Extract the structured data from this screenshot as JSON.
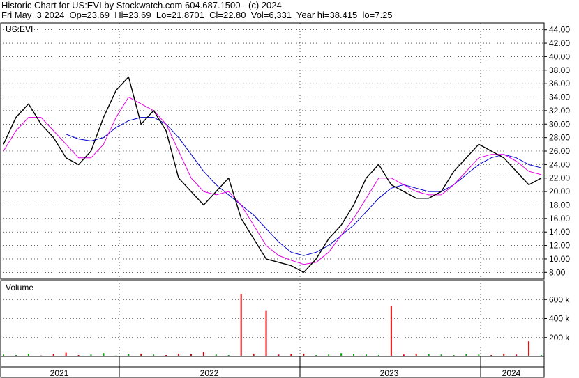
{
  "header": {
    "line1": "Historic Chart for US:EVI by Stockwatch.com 604.687.1500 - (c) 2024",
    "line2": "Fri May  3 2024  Op=23.69  Hi=23.69  Lo=21.8701  Cl=22.80  Vol=6,331  Year hi=38.415  lo=7.25"
  },
  "colors": {
    "price": "#000000",
    "ma_short": "#e600e6",
    "ma_long": "#0000cc",
    "vol_up": "#00aa00",
    "vol_down": "#dd0000",
    "grid": "#000000"
  },
  "chart_data": [
    {
      "type": "line",
      "title": "US:EVI",
      "ylim": [
        7,
        45
      ],
      "yticks": [
        "44.00",
        "42.00",
        "40.00",
        "38.00",
        "36.00",
        "34.00",
        "32.00",
        "30.00",
        "28.00",
        "26.00",
        "24.00",
        "22.00",
        "20.00",
        "18.00",
        "16.00",
        "14.00",
        "12.00",
        "10.00",
        "8.00"
      ],
      "x_labels": [
        "2021",
        "2022",
        "2023",
        "2024"
      ],
      "x": [
        "2020-10",
        "2020-11",
        "2020-12",
        "2021-01",
        "2021-02",
        "2021-03",
        "2021-04",
        "2021-05",
        "2021-06",
        "2021-07",
        "2021-08",
        "2021-09",
        "2021-10",
        "2021-11",
        "2021-12",
        "2022-01",
        "2022-02",
        "2022-03",
        "2022-04",
        "2022-05",
        "2022-06",
        "2022-07",
        "2022-08",
        "2022-09",
        "2022-10",
        "2022-11",
        "2022-12",
        "2023-01",
        "2023-02",
        "2023-03",
        "2023-04",
        "2023-05",
        "2023-06",
        "2023-07",
        "2023-08",
        "2023-09",
        "2023-10",
        "2023-11",
        "2023-12",
        "2024-01",
        "2024-02",
        "2024-03",
        "2024-04",
        "2024-05"
      ],
      "series": [
        {
          "values": [
            27,
            31,
            33,
            30,
            28,
            25,
            24,
            26,
            31,
            35,
            37,
            30,
            32,
            29,
            22,
            20,
            18,
            20,
            22,
            16,
            13,
            10,
            9.5,
            9,
            8,
            10,
            13,
            15,
            18,
            22,
            24,
            21,
            20,
            19,
            19,
            20,
            23,
            25,
            27,
            26,
            25,
            23,
            21,
            22
          ]
        },
        {
          "values": [
            26,
            29,
            31,
            31,
            29,
            27,
            25,
            25,
            27,
            31,
            34,
            33,
            32,
            30,
            26,
            22,
            20,
            19.5,
            20,
            18,
            15,
            12,
            10.5,
            9.8,
            9.2,
            9.5,
            11,
            13.5,
            16,
            19,
            22,
            22,
            21,
            20,
            19.5,
            19.5,
            21,
            23,
            25,
            25.5,
            25.5,
            24.5,
            23,
            22.5
          ]
        },
        {
          "values": [
            null,
            null,
            null,
            null,
            null,
            28.5,
            27.8,
            27.5,
            28,
            29.5,
            30.5,
            31,
            31,
            30,
            28,
            25.5,
            23,
            21,
            19.5,
            18,
            16.5,
            14.5,
            12.5,
            11,
            10.5,
            11,
            12,
            13.5,
            15,
            17,
            19,
            20.5,
            21,
            20.5,
            20,
            20,
            21,
            22.5,
            24,
            25,
            25.5,
            25,
            24,
            23.5
          ]
        }
      ]
    },
    {
      "type": "bar",
      "title": "Volume",
      "ylim": [
        0,
        800
      ],
      "yticks": [
        "600 k",
        "400 k",
        "200 k"
      ],
      "values": [
        20,
        15,
        30,
        10,
        25,
        40,
        15,
        20,
        35,
        10,
        25,
        30,
        20,
        15,
        30,
        25,
        45,
        20,
        15,
        660,
        30,
        480,
        20,
        25,
        30,
        15,
        20,
        35,
        25,
        20,
        15,
        530,
        20,
        30,
        25,
        20,
        15,
        25,
        20,
        15,
        30,
        20,
        160,
        15
      ]
    }
  ]
}
